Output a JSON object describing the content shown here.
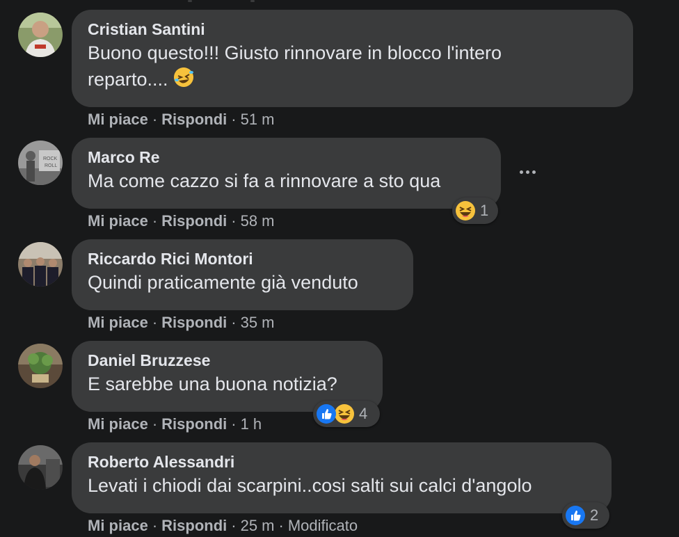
{
  "comments": [
    {
      "author": "Cristian Santini",
      "text_line1": "Buono questo!!! Giusto rinnovare in blocco l'intero",
      "text_line2": "reparto....",
      "inline_emoji": "laughing-rolling",
      "like": "Mi piace",
      "reply": "Rispondi",
      "time": "51 m"
    },
    {
      "author": "Marco Re",
      "text": "Ma come cazzo si fa a rinnovare a sto qua",
      "like": "Mi piace",
      "reply": "Rispondi",
      "time": "58 m",
      "reaction_count": "1",
      "reactions": [
        "haha"
      ]
    },
    {
      "author": "Riccardo Rici Montori",
      "text": "Quindi praticamente già venduto",
      "like": "Mi piace",
      "reply": "Rispondi",
      "time": "35 m"
    },
    {
      "author": "Daniel Bruzzese",
      "text": "E sarebbe una buona notizia?",
      "like": "Mi piace",
      "reply": "Rispondi",
      "time": "1 h",
      "reaction_count": "4",
      "reactions": [
        "like",
        "haha"
      ]
    },
    {
      "author": "Roberto Alessandri",
      "text": "Levati i chiodi dai scarpini..cosi salti sui calci d'angolo",
      "like": "Mi piace",
      "reply": "Rispondi",
      "time": "25 m",
      "edited": "Modificato",
      "reaction_count": "2",
      "reactions": [
        "like"
      ]
    }
  ],
  "separator": "·",
  "colors": {
    "background": "#18191a",
    "bubble": "#3a3b3c",
    "primary_text": "#e4e6eb",
    "secondary_text": "#b0b3b8",
    "like_blue": "#1877f2",
    "haha_yellow": "#f7c23c"
  }
}
